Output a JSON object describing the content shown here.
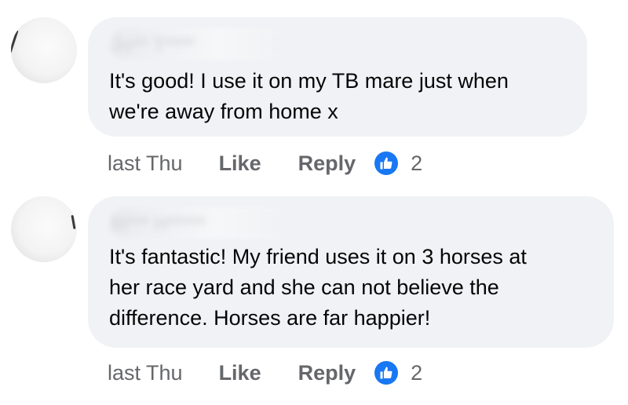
{
  "comments": [
    {
      "author": "Jo** T****",
      "text": "It's good! I use it on my TB mare just when\nwe're away from home x",
      "time": "last Thu",
      "like_label": "Like",
      "reply_label": "Reply",
      "reaction_icon": "thumbs-up-icon",
      "reaction_count": "2"
    },
    {
      "author": "M*** H*****",
      "text": "It's fantastic! My friend uses it on 3 horses at\nher race yard and she can not believe the\ndifference. Horses are far happier!",
      "time": "last Thu",
      "like_label": "Like",
      "reply_label": "Reply",
      "reaction_icon": "thumbs-up-icon",
      "reaction_count": "2"
    }
  ],
  "colors": {
    "bubble": "#f0f2f5",
    "action_text": "#65676b",
    "like_blue": "#1877f2"
  }
}
